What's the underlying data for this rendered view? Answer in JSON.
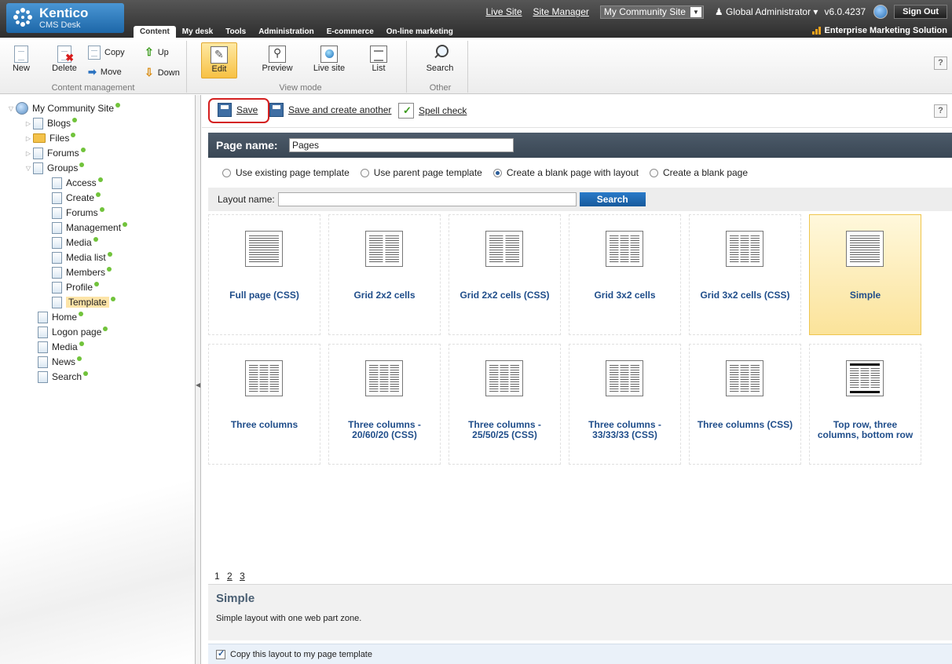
{
  "header": {
    "logo_name": "Kentico",
    "logo_sub": "CMS Desk",
    "links": [
      "Live Site",
      "Site Manager"
    ],
    "site_select": "My Community Site",
    "user": "Global Administrator",
    "version": "v6.0.4237",
    "sign_out": "Sign Out",
    "tabs": [
      "Content",
      "My desk",
      "Tools",
      "Administration",
      "E-commerce",
      "On-line marketing"
    ],
    "active_tab": "Content",
    "edition": "Enterprise Marketing Solution"
  },
  "ribbon": {
    "content_management": {
      "label": "Content management",
      "new": "New",
      "delete": "Delete",
      "copy": "Copy",
      "move": "Move",
      "up": "Up",
      "down": "Down"
    },
    "view_mode": {
      "label": "View mode",
      "edit": "Edit",
      "preview": "Preview",
      "live_site": "Live site",
      "list": "List"
    },
    "other": {
      "label": "Other",
      "search": "Search"
    },
    "help": "?"
  },
  "tree": {
    "root": "My Community Site",
    "items": [
      {
        "label": "Blogs"
      },
      {
        "label": "Files"
      },
      {
        "label": "Forums"
      },
      {
        "label": "Groups"
      },
      {
        "label": "Access"
      },
      {
        "label": "Create"
      },
      {
        "label": "Forums"
      },
      {
        "label": "Management"
      },
      {
        "label": "Media"
      },
      {
        "label": "Media list"
      },
      {
        "label": "Members"
      },
      {
        "label": "Profile"
      },
      {
        "label": "Template"
      },
      {
        "label": "Home"
      },
      {
        "label": "Logon page"
      },
      {
        "label": "Media"
      },
      {
        "label": "News"
      },
      {
        "label": "Search"
      }
    ],
    "selected": "Template"
  },
  "toolbar": {
    "save": "Save",
    "save_another": "Save and create another",
    "spell_check": "Spell check",
    "help": "?"
  },
  "form": {
    "page_name_label": "Page name:",
    "page_name_value": "Pages",
    "options": [
      "Use existing page template",
      "Use parent page template",
      "Create a blank page with layout",
      "Create a blank page"
    ],
    "selected_option": "Create a blank page with layout",
    "layout_name_label": "Layout name:",
    "layout_name_value": "",
    "search_button": "Search"
  },
  "layouts": [
    {
      "name": "Full page (CSS)",
      "icon": "full"
    },
    {
      "name": "Grid 2x2 cells",
      "icon": "grid2"
    },
    {
      "name": "Grid 2x2 cells (CSS)",
      "icon": "grid2"
    },
    {
      "name": "Grid 3x2 cells",
      "icon": "grid3"
    },
    {
      "name": "Grid 3x2 cells (CSS)",
      "icon": "grid3"
    },
    {
      "name": "Simple",
      "icon": "full"
    },
    {
      "name": "Three columns",
      "icon": "col3"
    },
    {
      "name": "Three columns - 20/60/20 (CSS)",
      "icon": "col3"
    },
    {
      "name": "Three columns - 25/50/25 (CSS)",
      "icon": "col3"
    },
    {
      "name": "Three columns - 33/33/33 (CSS)",
      "icon": "col3"
    },
    {
      "name": "Three columns (CSS)",
      "icon": "col3"
    },
    {
      "name": "Top row, three columns, bottom row",
      "icon": "topbottom"
    }
  ],
  "selected_layout": "Simple",
  "pager": {
    "current": "1",
    "pages": [
      "2",
      "3"
    ]
  },
  "description": {
    "title": "Simple",
    "text": "Simple layout with one web part zone."
  },
  "copy_layout": {
    "label": "Copy this layout to my page template",
    "checked": true
  }
}
